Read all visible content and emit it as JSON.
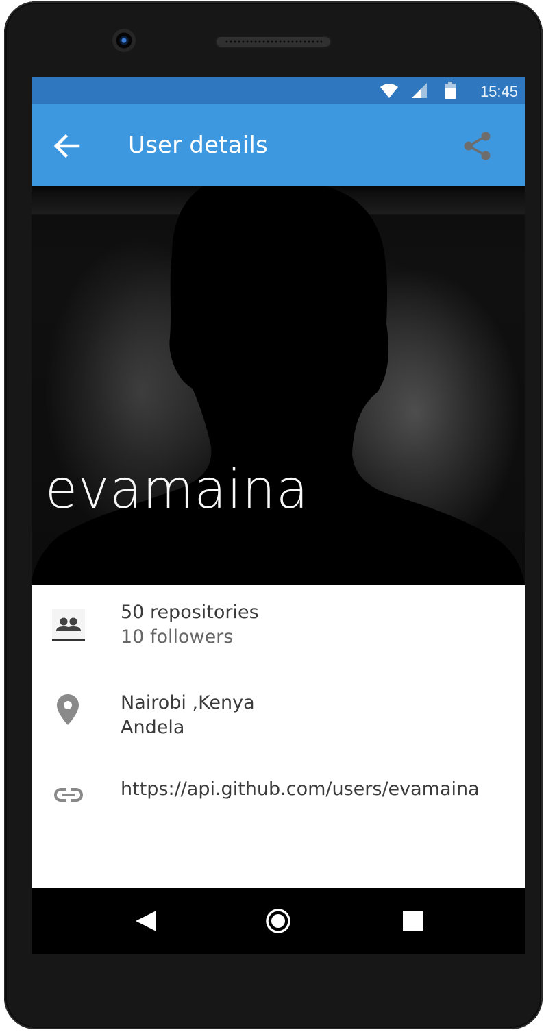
{
  "status_bar": {
    "time": "15:45",
    "icons": [
      "wifi-icon",
      "signal-icon",
      "battery-icon"
    ]
  },
  "app_bar": {
    "title": "User details",
    "back_icon": "arrow-left-icon",
    "share_icon": "share-icon",
    "background_color": "#3e98e0"
  },
  "profile": {
    "username": "evamaina",
    "avatar": "default-silhouette"
  },
  "details": {
    "stats": {
      "icon": "people-icon",
      "repositories": "50 repositories",
      "followers": "10 followers"
    },
    "location": {
      "icon": "location-pin-icon",
      "place": "Nairobi ,Kenya",
      "company": "Andela"
    },
    "link": {
      "icon": "link-icon",
      "url": "https://api.github.com/users/evamaina"
    }
  },
  "nav_bar": {
    "buttons": [
      "back-triangle-icon",
      "home-circle-icon",
      "recents-square-icon"
    ]
  }
}
